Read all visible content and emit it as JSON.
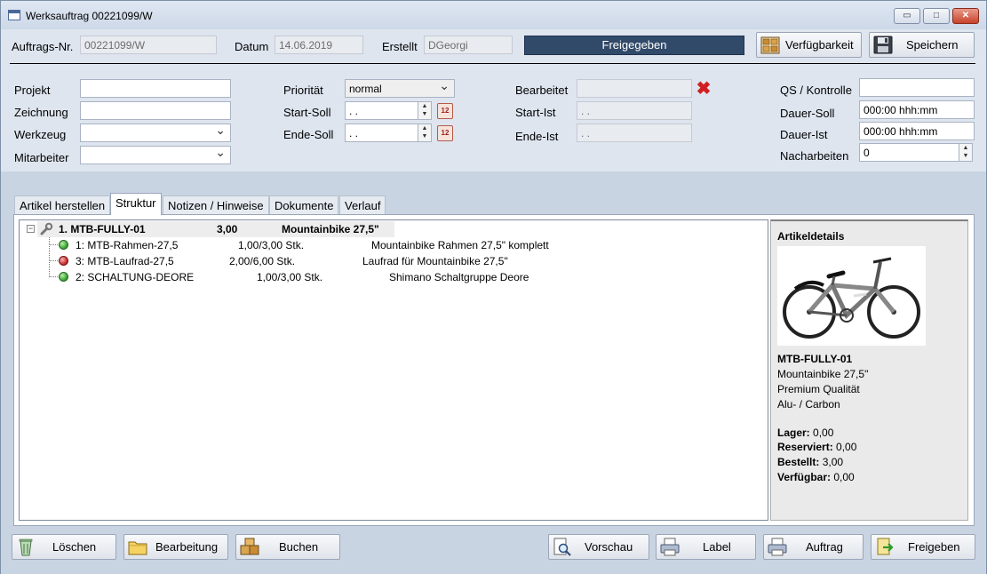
{
  "window": {
    "title": "Werksauftrag 00221099/W",
    "min_label": "▭",
    "max_label": "□",
    "close_label": "✕"
  },
  "header": {
    "auftrags_nr_label": "Auftrags-Nr.",
    "auftrags_nr_value": "00221099/W",
    "datum_label": "Datum",
    "datum_value": "14.06.2019",
    "erstellt_label": "Erstellt",
    "erstellt_value": "DGeorgi",
    "status": "Freigegeben",
    "verfuegbarkeit_label": "Verfügbarkeit",
    "speichern_label": "Speichern"
  },
  "form": {
    "projekt_label": "Projekt",
    "projekt_value": "",
    "zeichnung_label": "Zeichnung",
    "zeichnung_value": "",
    "werkzeug_label": "Werkzeug",
    "werkzeug_value": "",
    "mitarbeiter_label": "Mitarbeiter",
    "mitarbeiter_value": "",
    "prioritaet_label": "Priorität",
    "prioritaet_value": "normal",
    "start_soll_label": "Start-Soll",
    "start_soll_value": "  .  .",
    "ende_soll_label": "Ende-Soll",
    "ende_soll_value": "  .  .",
    "cal_label": "12",
    "bearbeitet_label": "Bearbeitet",
    "bearbeitet_value": "",
    "start_ist_label": "Start-Ist",
    "start_ist_value": "  .  .",
    "ende_ist_label": "Ende-Ist",
    "ende_ist_value": "  .  .",
    "qs_label": "QS / Kontrolle",
    "qs_value": "",
    "dauer_soll_label": "Dauer-Soll",
    "dauer_soll_value": "000:00 hhh:mm",
    "dauer_ist_label": "Dauer-Ist",
    "dauer_ist_value": "000:00 hhh:mm",
    "nacharbeiten_label": "Nacharbeiten",
    "nacharbeiten_value": "0"
  },
  "tabs": [
    {
      "label": "Artikel herstellen"
    },
    {
      "label": "Struktur"
    },
    {
      "label": "Notizen / Hinweise"
    },
    {
      "label": "Dokumente"
    },
    {
      "label": "Verlauf"
    }
  ],
  "tree": {
    "root": {
      "name": "1. MTB-FULLY-01",
      "qty": "3,00",
      "desc": "Mountainbike 27,5\""
    },
    "children": [
      {
        "name": "1: MTB-Rahmen-27,5",
        "qty": "1,00/3,00 Stk.",
        "desc": "Mountainbike Rahmen 27,5\" komplett",
        "status": "green"
      },
      {
        "name": "3: MTB-Laufrad-27,5",
        "qty": "2,00/6,00 Stk.",
        "desc": "Laufrad für Mountainbike 27,5\"",
        "status": "red"
      },
      {
        "name": "2: SCHALTUNG-DEORE",
        "qty": "1,00/3,00 Stk.",
        "desc": "Shimano Schaltgruppe Deore",
        "status": "green"
      }
    ]
  },
  "details": {
    "heading": "Artikeldetails",
    "article": "MTB-FULLY-01",
    "desc1": "Mountainbike 27,5\"",
    "desc2": "Premium Qualität",
    "desc3": "Alu- / Carbon",
    "lager_label": "Lager:",
    "lager_value": "0,00",
    "reserviert_label": "Reserviert:",
    "reserviert_value": "0,00",
    "bestellt_label": "Bestellt:",
    "bestellt_value": "3,00",
    "verfuegbar_label": "Verfügbar:",
    "verfuegbar_value": "0,00"
  },
  "bottom": {
    "loeschen": "Löschen",
    "bearbeitung": "Bearbeitung",
    "buchen": "Buchen",
    "vorschau": "Vorschau",
    "label": "Label",
    "auftrag": "Auftrag",
    "freigeben": "Freigeben"
  },
  "colors": {
    "status_bg": "#324a6a",
    "status_ok": "#2f9a2a",
    "status_bad": "#c42121"
  }
}
